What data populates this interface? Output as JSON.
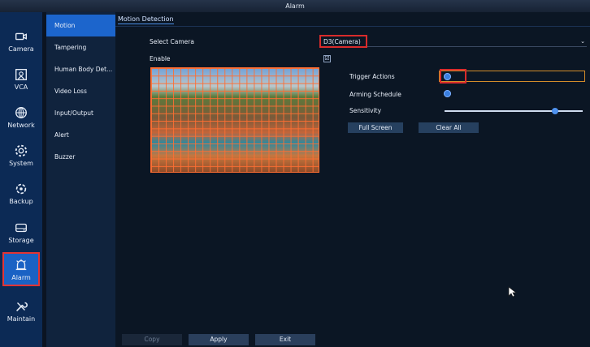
{
  "window": {
    "title": "Alarm"
  },
  "nav": [
    {
      "label": "Camera",
      "icon": "camera-icon"
    },
    {
      "label": "VCA",
      "icon": "vca-icon"
    },
    {
      "label": "Network",
      "icon": "network-icon"
    },
    {
      "label": "System",
      "icon": "system-icon"
    },
    {
      "label": "Backup",
      "icon": "backup-icon"
    },
    {
      "label": "Storage",
      "icon": "storage-icon"
    },
    {
      "label": "Alarm",
      "icon": "alarm-icon",
      "active": true
    },
    {
      "label": "Maintain",
      "icon": "maintain-icon"
    }
  ],
  "submenu": [
    {
      "label": "Motion",
      "active": true
    },
    {
      "label": "Tampering"
    },
    {
      "label": "Human Body Det..."
    },
    {
      "label": "Video Loss"
    },
    {
      "label": "Input/Output"
    },
    {
      "label": "Alert"
    },
    {
      "label": "Buzzer"
    }
  ],
  "main": {
    "tab": "Motion Detection",
    "select_camera_label": "Select Camera",
    "select_camera_value": "D3(Camera)",
    "enable_label": "Enable",
    "enable_checked": "☑",
    "trigger_actions_label": "Trigger Actions",
    "arming_schedule_label": "Arming Schedule",
    "sensitivity_label": "Sensitivity",
    "sensitivity_level": 0.8,
    "full_screen_label": "Full Screen",
    "clear_all_label": "Clear All"
  },
  "footer": {
    "copy": "Copy",
    "apply": "Apply",
    "exit": "Exit"
  },
  "colors": {
    "highlight": "#d92b2b",
    "accent": "#1c65cc",
    "grid": "#ff6e32"
  }
}
